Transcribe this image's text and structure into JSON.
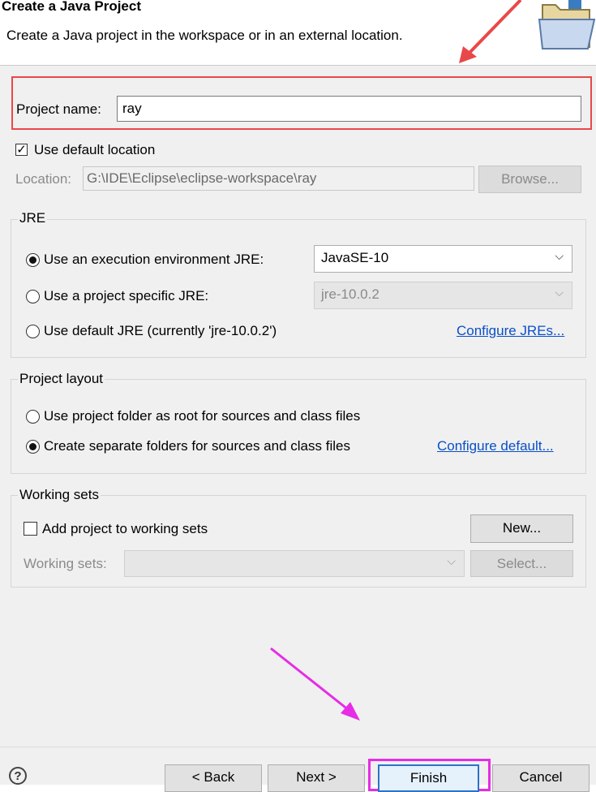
{
  "header": {
    "title": "Create a Java Project",
    "description": "Create a Java project in the workspace or in an external location.",
    "icon": "folder-icon"
  },
  "project": {
    "label": "Project name:",
    "value": "ray"
  },
  "default_location": {
    "checked": true,
    "label": "Use default location"
  },
  "location": {
    "label": "Location:",
    "value": "G:\\IDE\\Eclipse\\eclipse-workspace\\ray",
    "browse_label": "Browse..."
  },
  "jre": {
    "title": "JRE",
    "option_env": "Use an execution environment JRE:",
    "option_env_value": "JavaSE-10",
    "option_specific": "Use a project specific JRE:",
    "option_specific_value": "jre-10.0.2",
    "option_default": "Use default JRE (currently 'jre-10.0.2')",
    "configure_link": "Configure JREs...",
    "selected": "execution-environment"
  },
  "layout": {
    "title": "Project layout",
    "option_root": "Use project folder as root for sources and class files",
    "option_separate": "Create separate folders for sources and class files",
    "configure_link": "Configure default...",
    "selected": "separate-folders"
  },
  "working_sets": {
    "title": "Working sets",
    "add_label": "Add project to working sets",
    "add_checked": false,
    "new_label": "New...",
    "sets_label": "Working sets:",
    "select_label": "Select..."
  },
  "footer": {
    "help_label": "?",
    "back_label": "< Back",
    "next_label": "Next >",
    "finish_label": "Finish",
    "cancel_label": "Cancel"
  },
  "colors": {
    "highlight_red": "#e8484a",
    "highlight_magenta": "#e62ce6",
    "link": "#0a4fc7",
    "panel_bg": "#f0f0f0"
  }
}
